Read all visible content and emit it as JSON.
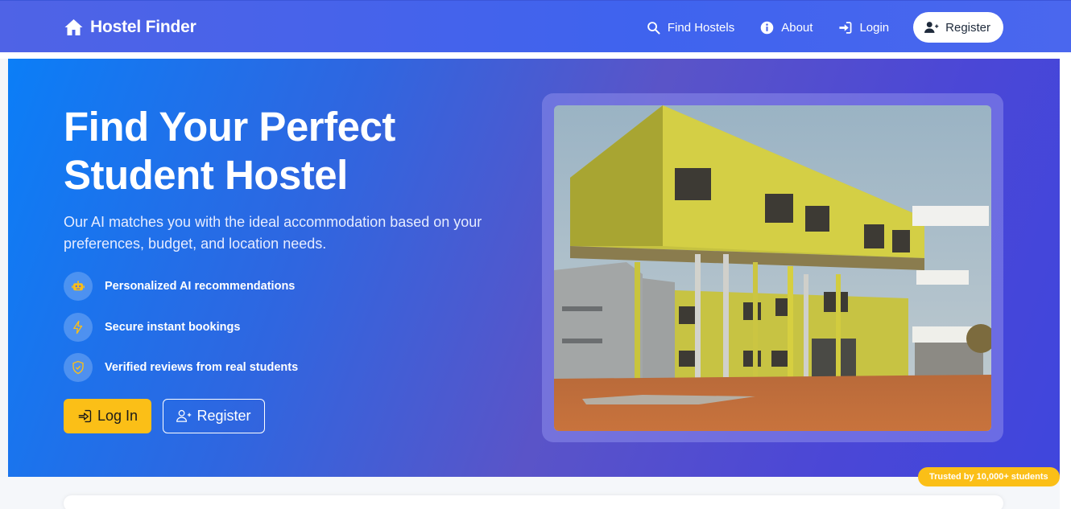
{
  "nav": {
    "brand": "Hostel Finder",
    "links": [
      {
        "label": "Find Hostels",
        "icon": "search-icon"
      },
      {
        "label": "About",
        "icon": "info-icon"
      },
      {
        "label": "Login",
        "icon": "sign-in-icon"
      }
    ],
    "register_label": "Register"
  },
  "hero": {
    "title_line1": "Find Your Perfect",
    "title_line2": "Student Hostel",
    "subtitle": "Our AI matches you with the ideal accommodation based on your preferences, budget, and location needs.",
    "features": [
      {
        "label": "Personalized AI recommendations",
        "icon": "robot-icon"
      },
      {
        "label": "Secure instant bookings",
        "icon": "lightning-icon"
      },
      {
        "label": "Verified reviews from real students",
        "icon": "shield-check-icon"
      }
    ],
    "login_label": "Log In",
    "register_label": "Register",
    "badge": "Trusted by 10,000+ students"
  },
  "colors": {
    "accent_yellow": "#fbbf17",
    "nav_blue": "#4263eb",
    "hero_start": "#0b7ef7",
    "hero_end": "#3f46dd"
  }
}
